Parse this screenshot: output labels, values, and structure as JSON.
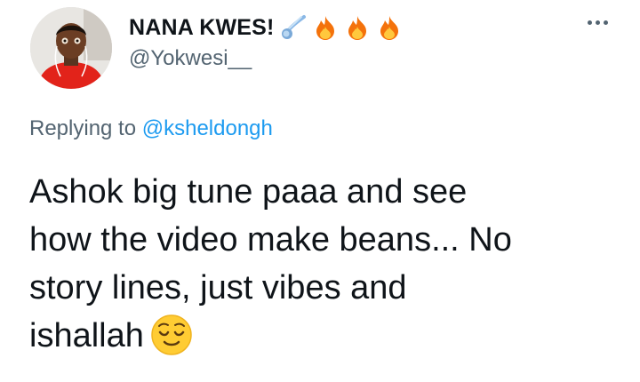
{
  "user": {
    "display_name": "NANA KWES!",
    "handle": "@Yokwesi__",
    "name_emojis": [
      "comet-icon",
      "fire-icon",
      "fire-icon",
      "fire-icon"
    ]
  },
  "reply": {
    "prefix": "Replying to",
    "mention": "@ksheldongh"
  },
  "tweet": {
    "lines": [
      "Ashok big tune paaa and see",
      "how the video make beans... No",
      "story lines, just vibes and",
      "ishallah"
    ],
    "trailing_emoji": "relieved-face-icon"
  },
  "colors": {
    "text": "#0f1419",
    "secondary": "#536471",
    "link": "#1d9bf0"
  }
}
